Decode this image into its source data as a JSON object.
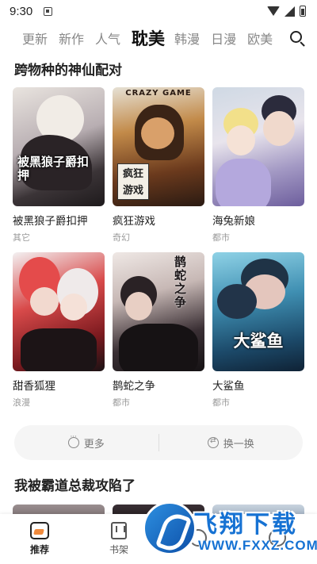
{
  "status_bar": {
    "time": "9:30"
  },
  "tabs": [
    {
      "label": "更新",
      "active": false
    },
    {
      "label": "新作",
      "active": false
    },
    {
      "label": "人气",
      "active": false
    },
    {
      "label": "耽美",
      "active": true
    },
    {
      "label": "韩漫",
      "active": false
    },
    {
      "label": "日漫",
      "active": false
    },
    {
      "label": "欧美",
      "active": false
    }
  ],
  "section1": {
    "title": "跨物种的神仙配对",
    "comics": [
      {
        "title": "被黑狼子爵扣押",
        "genre": "其它",
        "cover_text": "被黑狼子爵扣押"
      },
      {
        "title": "疯狂游戏",
        "genre": "奇幻",
        "cover_text": "CRAZY GAME",
        "cover_badge": "疯狂游戏"
      },
      {
        "title": "海兔新娘",
        "genre": "都市"
      },
      {
        "title": "甜香狐狸",
        "genre": "浪漫"
      },
      {
        "title": "鹊蛇之争",
        "genre": "都市",
        "cover_text": "鹊蛇之争"
      },
      {
        "title": "大鲨鱼",
        "genre": "都市",
        "cover_text": "大鲨鱼"
      }
    ]
  },
  "actions": {
    "more_label": "更多",
    "refresh_label": "换一换"
  },
  "section2": {
    "title": "我被霸道总裁攻陷了"
  },
  "bottom_nav": [
    {
      "label": "推荐",
      "active": true
    },
    {
      "label": "书架",
      "active": false
    },
    {
      "label": "",
      "active": false
    },
    {
      "label": "",
      "active": false
    }
  ],
  "watermark": {
    "title": "飞翔下载",
    "url": "WWW.FXXZ.COM"
  },
  "colors": {
    "accent": "#f08a3c",
    "watermark_blue": "#1672d3"
  }
}
